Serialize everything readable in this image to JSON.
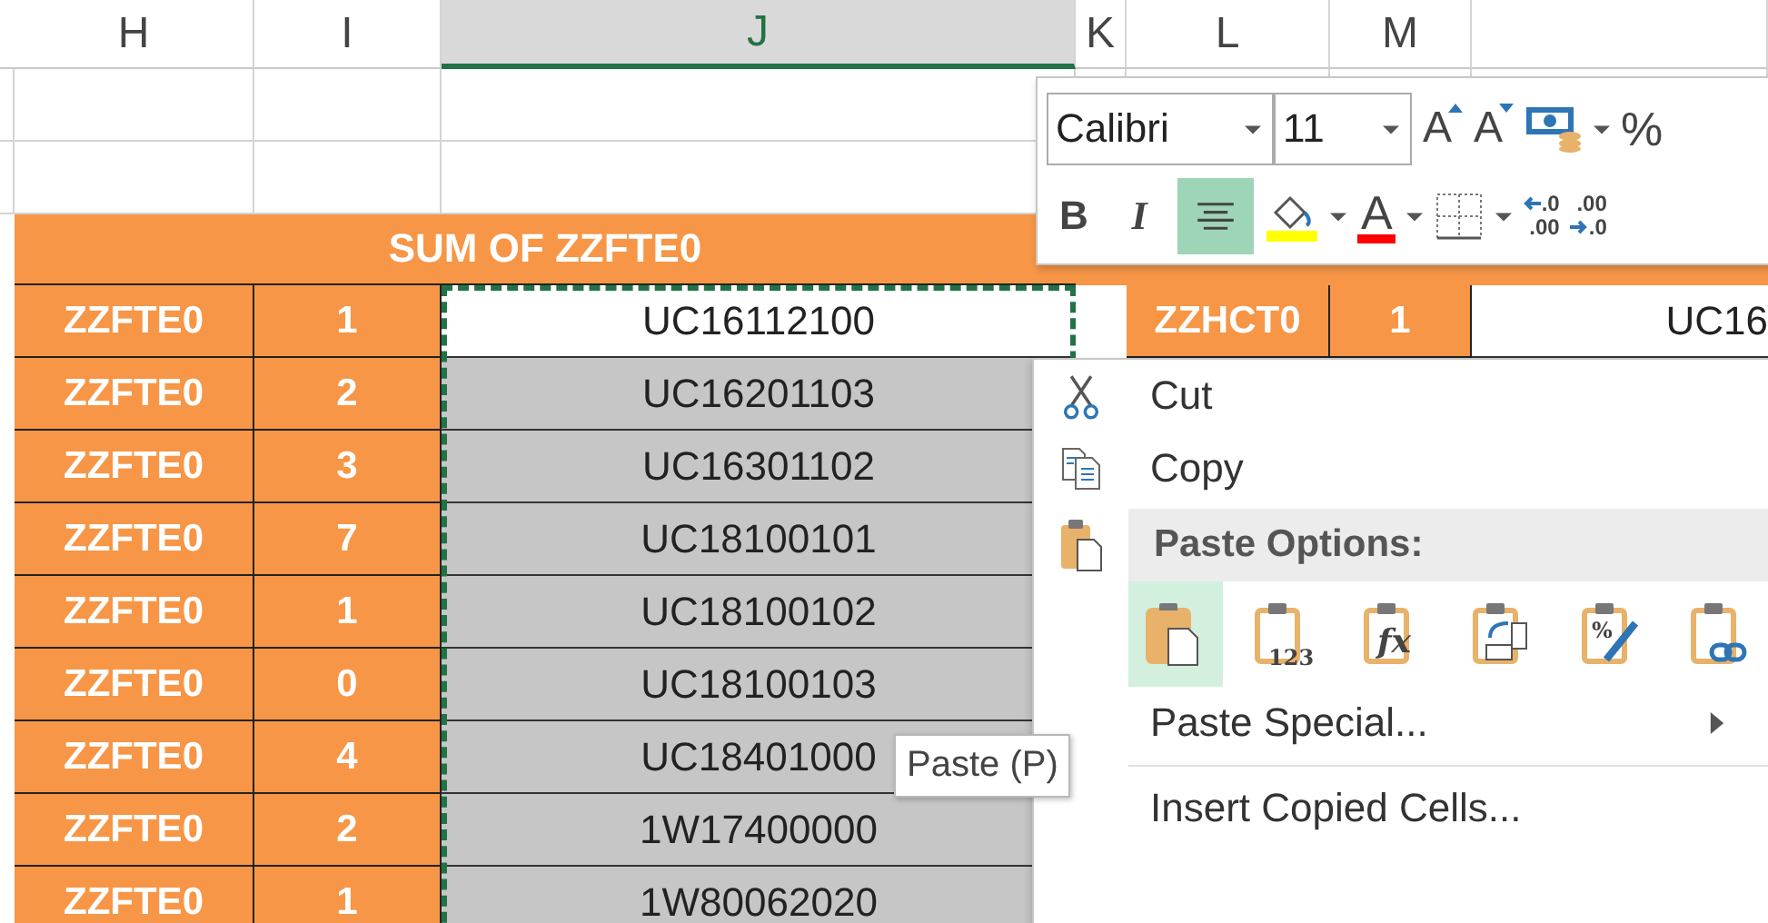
{
  "column_headers": [
    {
      "label": "H",
      "selected": false
    },
    {
      "label": "I",
      "selected": false
    },
    {
      "label": "J",
      "selected": true
    },
    {
      "label": "K",
      "selected": false
    },
    {
      "label": "L",
      "selected": false
    },
    {
      "label": "M",
      "selected": false
    }
  ],
  "table_title": "SUM OF ZZFTE0",
  "rows": [
    {
      "name": "ZZFTE0",
      "value": "1",
      "code": "UC16112100",
      "selected": false
    },
    {
      "name": "ZZFTE0",
      "value": "2",
      "code": "UC16201103",
      "selected": true
    },
    {
      "name": "ZZFTE0",
      "value": "3",
      "code": "UC16301102",
      "selected": true
    },
    {
      "name": "ZZFTE0",
      "value": "7",
      "code": "UC18100101",
      "selected": true
    },
    {
      "name": "ZZFTE0",
      "value": "1",
      "code": "UC18100102",
      "selected": true
    },
    {
      "name": "ZZFTE0",
      "value": "0",
      "code": "UC18100103",
      "selected": true
    },
    {
      "name": "ZZFTE0",
      "value": "4",
      "code": "UC18401000",
      "selected": true
    },
    {
      "name": "ZZFTE0",
      "value": "2",
      "code": "1W17400000",
      "selected": true
    },
    {
      "name": "ZZFTE0",
      "value": "1",
      "code": "1W80062020",
      "selected": true
    }
  ],
  "right_row": {
    "name": "ZZHCT0",
    "value": "1",
    "code": "UC16"
  },
  "mini_toolbar": {
    "font": "Calibri",
    "size": "11",
    "grow_font": "A",
    "shrink_font": "A",
    "percent": "%",
    "bold": "B",
    "italic": "I",
    "align_center_on": true,
    "font_color": "A",
    "increase_decimal": [
      ".0",
      ".00"
    ],
    "decrease_decimal": [
      ".00",
      ".0"
    ]
  },
  "context_menu": {
    "items": [
      {
        "kind": "command",
        "label": "Cut"
      },
      {
        "kind": "command",
        "label": "Copy"
      },
      {
        "kind": "header",
        "label": "Paste Options:"
      },
      {
        "kind": "paste_options",
        "options": [
          {
            "kind": "paste",
            "selected": true
          },
          {
            "kind": "values",
            "glyph": "123",
            "selected": false
          },
          {
            "kind": "formulas",
            "glyph": "fx",
            "selected": false
          },
          {
            "kind": "transpose",
            "selected": false
          },
          {
            "kind": "formatting",
            "glyph": "%",
            "selected": false
          },
          {
            "kind": "link",
            "selected": false
          }
        ]
      },
      {
        "kind": "submenu",
        "label": "Paste Special..."
      },
      {
        "kind": "command",
        "label": "Insert Copied Cells..."
      }
    ]
  },
  "tooltip": "Paste (P)"
}
